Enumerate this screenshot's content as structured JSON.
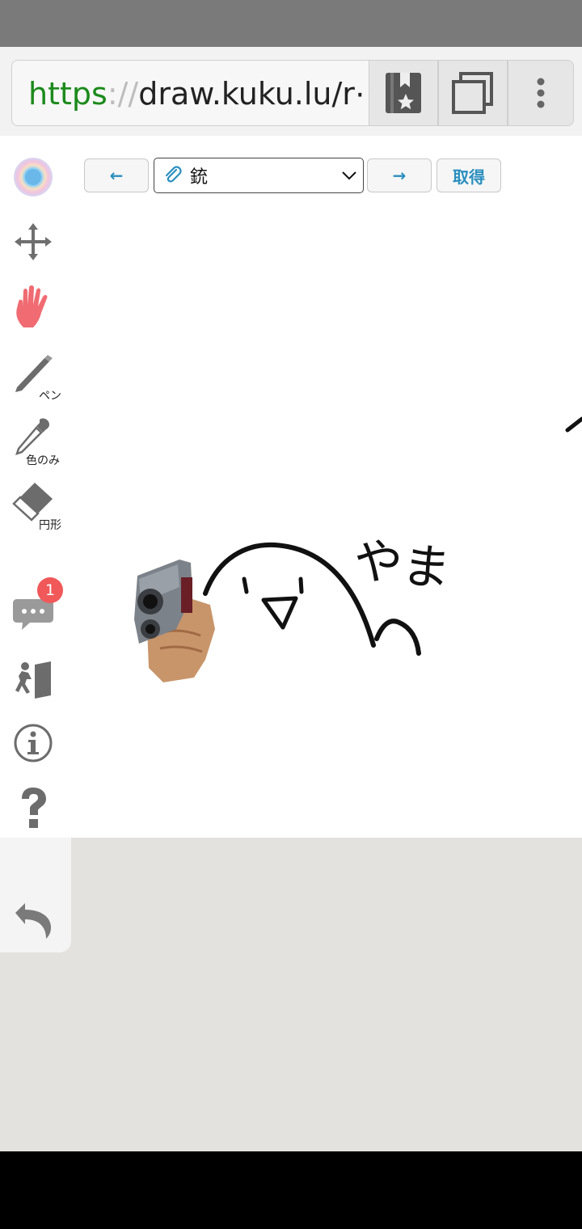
{
  "browser": {
    "url_scheme": "https",
    "url_sep": "://",
    "url_rest": "draw.kuku.lu/r⋯",
    "bookmark_icon": "bookmark-star-icon",
    "tabs_icon": "tabs-icon",
    "menu_icon": "more-vert-icon"
  },
  "toolbar": {
    "prev_label": "←",
    "next_label": "→",
    "stamp_select_value": "銃",
    "get_label": "取得",
    "accent_color": "#2a8fbf"
  },
  "tools": {
    "pen_label": "ペン",
    "dropper_label": "色のみ",
    "eraser_label": "円形",
    "chat_badge": "1"
  },
  "canvas": {
    "doodle_text": "やま"
  }
}
